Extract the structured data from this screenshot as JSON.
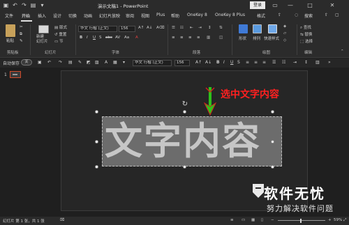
{
  "window": {
    "title": "演示文稿1 - PowerPoint",
    "login_label": "登录",
    "minimize_glyph": "—",
    "maximize_glyph": "□",
    "close_glyph": "✕"
  },
  "menu": {
    "tabs": [
      "文件",
      "开始",
      "插入",
      "设计",
      "切换",
      "动画",
      "幻灯片放映",
      "审阅",
      "视图",
      "Plus",
      "帮助",
      "OneKey 8",
      "OneKey 8 Plus",
      "格式"
    ],
    "active": "开始",
    "search_label": "搜索"
  },
  "ribbon": {
    "paste_label": "粘贴",
    "clipboard_group": "剪贴板",
    "new_slide_label": "新建\n幻灯片",
    "layout_label": "版式",
    "reset_label": "重置",
    "section_label": "节",
    "slides_group": "幻灯片",
    "font_name": "华文 行楷 (正文)",
    "font_size": "156",
    "font_group": "字体",
    "paragraph_group": "段落",
    "shape_label": "形状",
    "arrange_label": "排列",
    "quick_style_label": "快速样式",
    "drawing_group": "绘图",
    "find_label": "查找",
    "replace_label": "替换",
    "select_label": "选择",
    "editing_group": "编辑"
  },
  "toolbar": {
    "autosave_label": "自动保存",
    "autosave_state": "关",
    "font_name": "华文 行楷 (正文)",
    "font_size": "156"
  },
  "slides": {
    "number": "1"
  },
  "canvas": {
    "text": "文字内容",
    "annotation": "选中文字内容"
  },
  "watermark": {
    "title": "软件无忧",
    "subtitle": "努力解决软件问题"
  },
  "statusbar": {
    "slide_info": "幻灯片 第 1 张，共 1 张",
    "zoom": "59%"
  },
  "colors": {
    "annotation": "#ff2020",
    "arrow": "#2ec21b",
    "thumbnail_border": "#d04a2a"
  }
}
